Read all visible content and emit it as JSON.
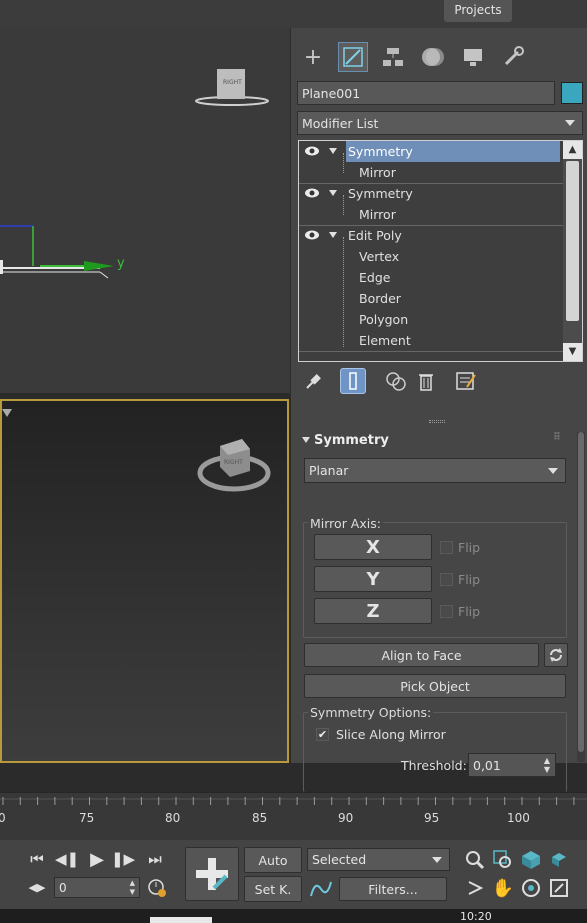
{
  "topbar": {
    "projects_label": "Projects"
  },
  "viewports": {
    "top_right_cube_label": "RIGHT",
    "bottom_cube_label": "RIGHT",
    "axis_y_label": "y"
  },
  "command_panel": {
    "tabs": [
      "create-icon",
      "modify-icon",
      "hierarchy-icon",
      "motion-icon",
      "display-icon",
      "utilities-icon"
    ],
    "object_name": "Plane001",
    "object_color": "#3aa7bf",
    "modifier_list_label": "Modifier List",
    "stack": [
      {
        "label": "Symmetry",
        "kind": "modifier",
        "selected": true
      },
      {
        "label": "Mirror",
        "kind": "sub"
      },
      {
        "label": "Symmetry",
        "kind": "modifier"
      },
      {
        "label": "Mirror",
        "kind": "sub"
      },
      {
        "label": "Edit Poly",
        "kind": "modifier"
      },
      {
        "label": "Vertex",
        "kind": "sub"
      },
      {
        "label": "Edge",
        "kind": "sub"
      },
      {
        "label": "Border",
        "kind": "sub"
      },
      {
        "label": "Polygon",
        "kind": "sub"
      },
      {
        "label": "Element",
        "kind": "sub"
      }
    ],
    "stack_tools": [
      "pin-stack-icon",
      "show-end-result-icon",
      "make-unique-icon",
      "remove-modifier-icon",
      "configure-modifier-sets-icon"
    ]
  },
  "rollout": {
    "title": "Symmetry",
    "mode": "Planar",
    "mirror_axis_title": "Mirror Axis:",
    "axes": [
      "X",
      "Y",
      "Z"
    ],
    "flip_label": "Flip",
    "align_to_face": "Align to Face",
    "pick_object": "Pick Object",
    "symmetry_options_title": "Symmetry Options:",
    "slice_along_mirror": "Slice Along Mirror",
    "slice_checked": true,
    "threshold_label": "Threshold:",
    "threshold_value": "0,01"
  },
  "timeline": {
    "ticks": [
      "0",
      "75",
      "80",
      "85",
      "90",
      "95",
      "100"
    ]
  },
  "bottom": {
    "auto_label": "Auto",
    "setk_label": "Set K.",
    "selected_label": "Selected",
    "filters_label": "Filters...",
    "frame_value": "0",
    "clock": "10:20"
  },
  "colors": {
    "accent": "#6f8fb8",
    "viewport_border": "#b99a3a"
  }
}
